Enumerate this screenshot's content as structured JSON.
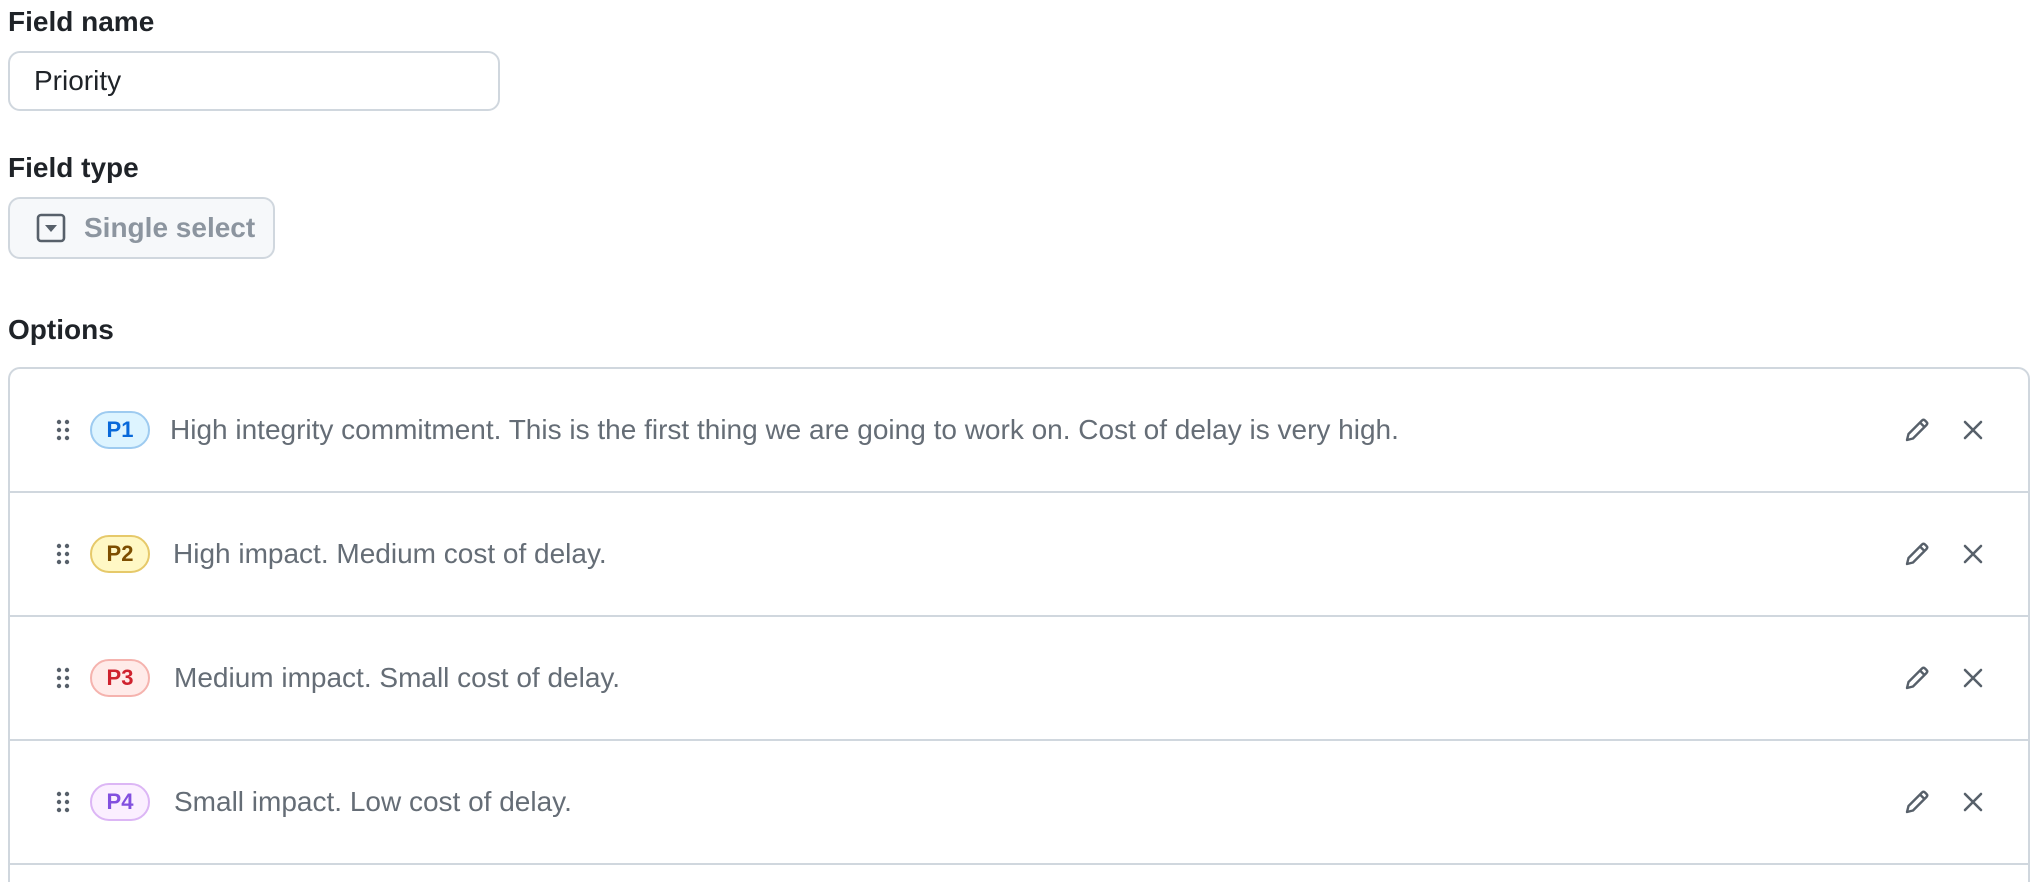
{
  "field_name": {
    "label": "Field name",
    "value": "Priority"
  },
  "field_type": {
    "label": "Field type",
    "value": "Single select",
    "icon": "single-select-icon"
  },
  "options": {
    "label": "Options",
    "items": [
      {
        "badge": "P1",
        "description": "High integrity commitment. This is the first thing we are going to work on. Cost of delay is very high.",
        "badge_bg": "#ddf4ff",
        "badge_border": "#9ecbf0",
        "badge_text": "#0969da"
      },
      {
        "badge": "P2",
        "description": "High impact. Medium cost of delay.",
        "badge_bg": "#fff8c5",
        "badge_border": "#e6c96a",
        "badge_text": "#7d4e00"
      },
      {
        "badge": "P3",
        "description": "Medium impact. Small cost of delay.",
        "badge_bg": "#ffebe9",
        "badge_border": "#f5b3ae",
        "badge_text": "#cf222e"
      },
      {
        "badge": "P4",
        "description": "Small impact. Low cost of delay.",
        "badge_bg": "#fbefff",
        "badge_border": "#dcb6f5",
        "badge_text": "#8250df"
      }
    ]
  }
}
